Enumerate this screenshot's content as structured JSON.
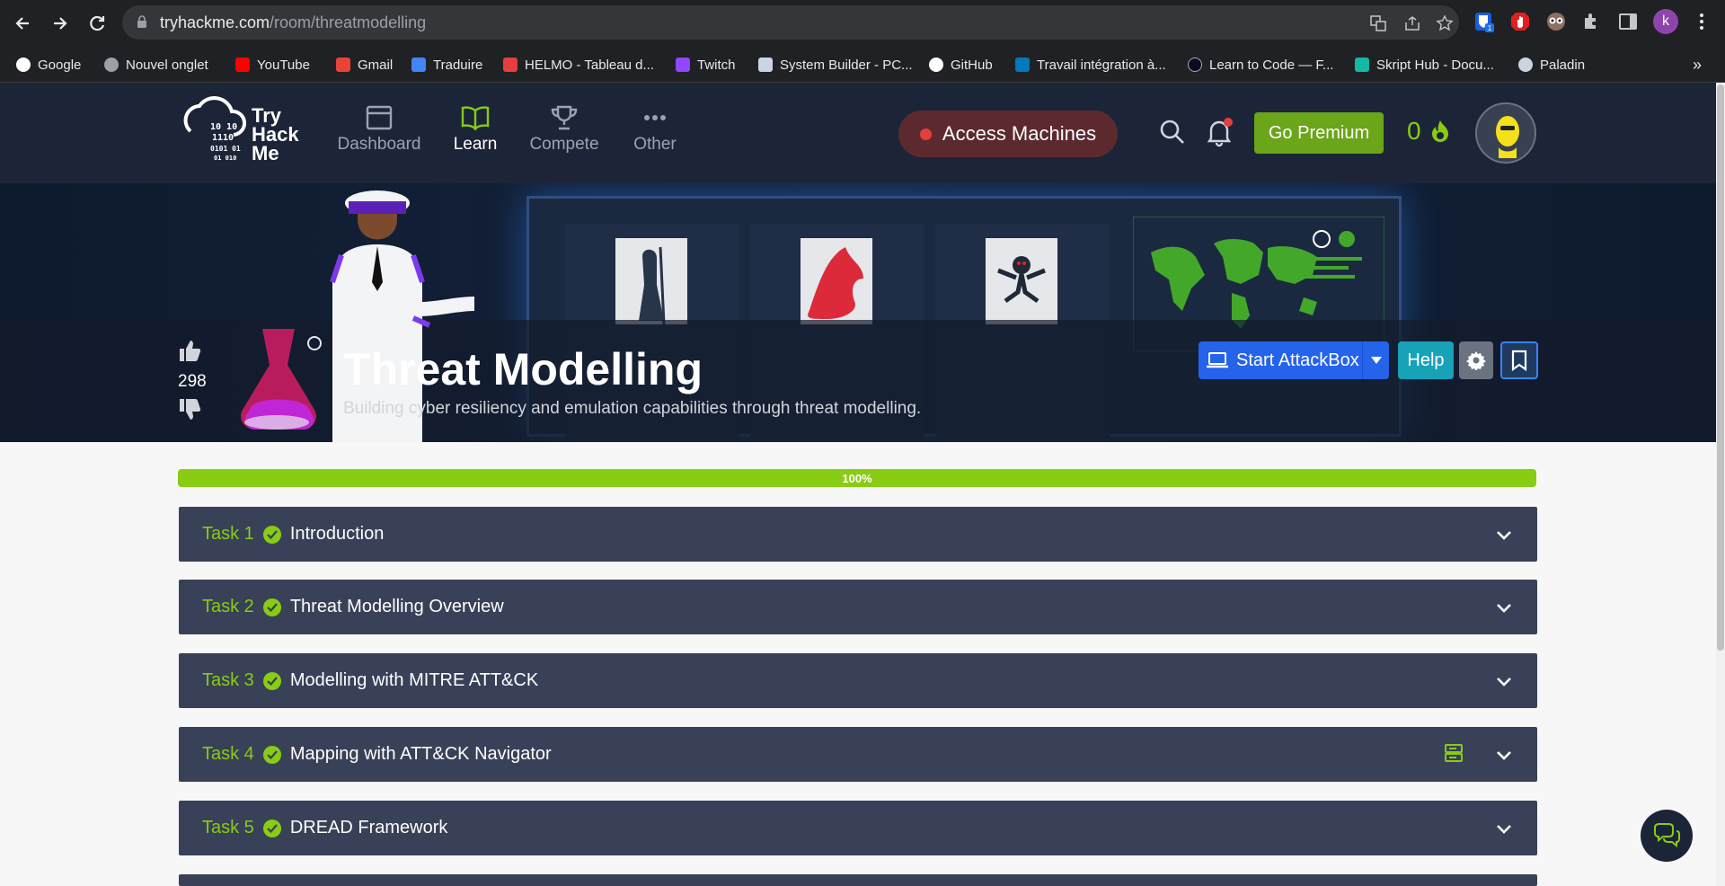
{
  "browser": {
    "url_host": "tryhackme.com",
    "url_path": "/room/threatmodelling",
    "profile_initial": "k",
    "ext_badge": "1"
  },
  "bookmarks": [
    {
      "label": "Google",
      "color": "#ffffff"
    },
    {
      "label": "Nouvel onglet",
      "color": "#9aa0a6"
    },
    {
      "label": "YouTube",
      "color": "#ff0000"
    },
    {
      "label": "Gmail",
      "color": "#ea4335"
    },
    {
      "label": "Traduire",
      "color": "#4285f4"
    },
    {
      "label": "HELMO - Tableau d...",
      "color": "#e53e3e"
    },
    {
      "label": "Twitch",
      "color": "#9146ff"
    },
    {
      "label": "System Builder - PC...",
      "color": "#cbd5e1"
    },
    {
      "label": "GitHub",
      "color": "#ffffff"
    },
    {
      "label": "Travail intégration à...",
      "color": "#0079bf"
    },
    {
      "label": "Learn to Code — F...",
      "color": "#0a0a23"
    },
    {
      "label": "Skript Hub - Docu...",
      "color": "#14b8a6"
    },
    {
      "label": "Paladin",
      "color": "#cbd5e1"
    }
  ],
  "header": {
    "logo_lines": [
      "Try",
      "Hack",
      "Me"
    ],
    "nav": [
      {
        "label": "Dashboard",
        "icon": "dashboard-icon"
      },
      {
        "label": "Learn",
        "icon": "book-icon",
        "active": true
      },
      {
        "label": "Compete",
        "icon": "trophy-icon"
      },
      {
        "label": "Other",
        "icon": "ellipsis-icon"
      }
    ],
    "access_label": "Access Machines",
    "premium_label": "Go Premium",
    "streak": "0",
    "accent": "#88cc14"
  },
  "room": {
    "votes": "298",
    "title": "Threat Modelling",
    "subtitle": "Building cyber resiliency and emulation capabilities through threat modelling.",
    "attackbox_label": "Start AttackBox",
    "help_label": "Help"
  },
  "progress": {
    "value": 100,
    "label": "100%"
  },
  "tasks": [
    {
      "num": "Task 1",
      "title": "Introduction"
    },
    {
      "num": "Task 2",
      "title": "Threat Modelling Overview"
    },
    {
      "num": "Task 3",
      "title": "Modelling with MITRE ATT&CK"
    },
    {
      "num": "Task 4",
      "title": "Mapping with ATT&CK Navigator"
    },
    {
      "num": "Task 5",
      "title": "DREAD Framework"
    }
  ]
}
